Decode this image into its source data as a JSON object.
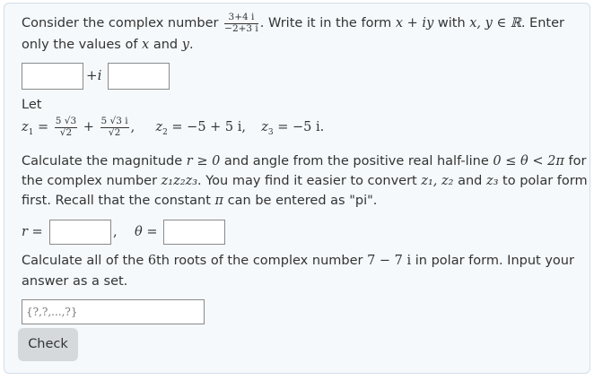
{
  "q1": {
    "intro": "Consider the complex number",
    "frac_num": "3+4 i",
    "frac_den": "−2+3 i",
    "after_frac": ". Write it in the form",
    "form": "x + iy",
    "with": "with",
    "set_cond": "x, y ∈ ℝ",
    "enter": ". Enter",
    "line2_a": "only the values of",
    "x": "x",
    "and": "and",
    "y": "y",
    "period": ".",
    "plus_i": "+i"
  },
  "q2": {
    "let": "Let",
    "z1": "z",
    "sub1": "1",
    "eq": "=",
    "f1_num": "5 √3",
    "f1_den": "√2",
    "plus": "+",
    "f2_num": "5 √3 i",
    "f2_den": "√2",
    "comma": ",",
    "z2_expr": "= −5 + 5 i,",
    "z3_expr": "= −5 i.",
    "sub2": "2",
    "sub3": "3",
    "calc_a": "Calculate the magnitude",
    "r_cond": "r ≥ 0",
    "calc_b": "and angle from the positive real half-line",
    "theta_cond": "0 ≤ θ < 2π",
    "calc_c": "for",
    "line2_a": "the complex number",
    "prod": "z₁z₂z₃",
    "line2_b": ". You may find it easier to convert",
    "conv": "z₁, z₂",
    "line2_c": "and",
    "z3": "z₃",
    "line2_d": "to polar form",
    "line3_a": "first. Recall that the constant",
    "pi": "π",
    "line3_b": "can be entered as \"pi\".",
    "r_label": "r =",
    "sep": ",",
    "theta_label": "θ ="
  },
  "q3": {
    "line1_a": "Calculate all of the",
    "n": "6",
    "line1_b": "th roots of the complex number",
    "num": "7 − 7 i",
    "line1_c": "in polar form. Input your",
    "line2": "answer as a set.",
    "placeholder": "{?,?,...,?}"
  },
  "check_label": "Check"
}
